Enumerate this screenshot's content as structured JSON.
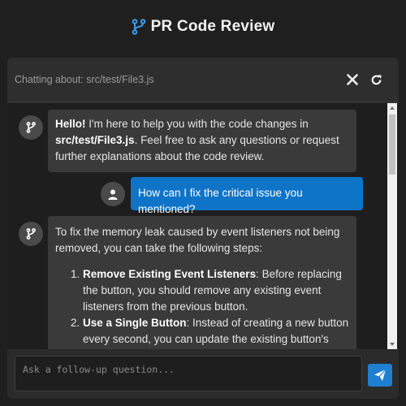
{
  "header": {
    "title": "PR Code Review",
    "icon": "git-branch-icon",
    "accent": "#3b9be8"
  },
  "toolbar": {
    "context": "Chatting about: src/test/File3.js",
    "close_icon": "close-icon",
    "refresh_icon": "refresh-icon"
  },
  "messages": {
    "m1": {
      "role": "assistant",
      "greeting": "Hello!",
      "text_a": " I'm here to help you with the code changes in ",
      "file": "src/test/File3.js",
      "text_b": ". Feel free to ask any questions or request further explanations about the code review."
    },
    "m2": {
      "role": "user",
      "text": "How can I fix the critical issue you mentioned?"
    },
    "m3": {
      "role": "assistant",
      "intro": "To fix the memory leak caused by event listeners not being removed, you can take the following steps:",
      "steps": [
        {
          "title": "Remove Existing Event Listeners",
          "text": ": Before replacing the button, you should remove any existing event listeners from the previous button."
        },
        {
          "title": "Use a Single Button",
          "text": ": Instead of creating a new button every second, you can update the existing button's"
        }
      ]
    }
  },
  "composer": {
    "placeholder": "Ask a follow-up question...",
    "value": "",
    "send_icon": "send-icon"
  },
  "colors": {
    "user_bubble": "#0e74c8",
    "assistant_bubble": "#3a3a3a",
    "send_button": "#1f7fd1"
  }
}
